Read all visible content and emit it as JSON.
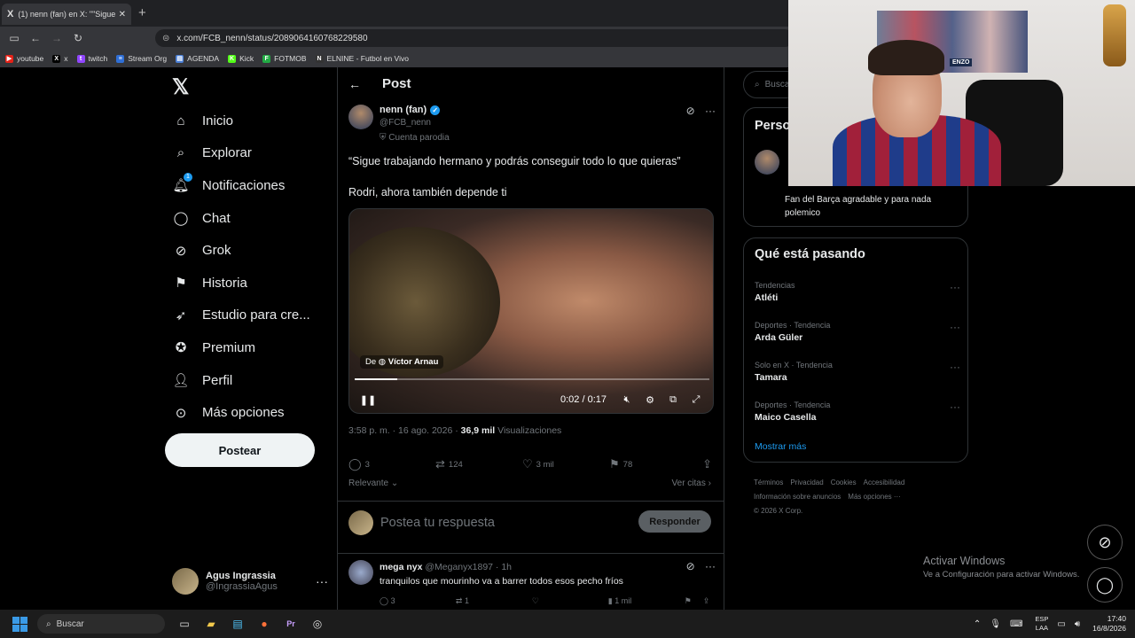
{
  "browser": {
    "tab_title": "(1) nenn (fan) en X: \"\"Sigue tra...",
    "url": "x.com/FCB_nenn/status/2089064160768229580",
    "bookmarks": [
      {
        "label": "youtube",
        "color": "#e62117",
        "glyph": "▶"
      },
      {
        "label": "x",
        "color": "#000000",
        "glyph": "X"
      },
      {
        "label": "twitch",
        "color": "#9146ff",
        "glyph": "t"
      },
      {
        "label": "Stream Org",
        "color": "#2f6fd6",
        "glyph": "≡"
      },
      {
        "label": "AGENDA",
        "color": "#4a7fd6",
        "glyph": "▤"
      },
      {
        "label": "Kick",
        "color": "#53fc18",
        "glyph": "K"
      },
      {
        "label": "FOTMOB",
        "color": "#22aa44",
        "glyph": "F"
      },
      {
        "label": "ELNINE - Futbol en Vivo",
        "color": "#333333",
        "glyph": "N"
      }
    ]
  },
  "nav": {
    "items": [
      {
        "label": "Inicio",
        "icon": "home-icon"
      },
      {
        "label": "Explorar",
        "icon": "search-icon"
      },
      {
        "label": "Notificaciones",
        "icon": "bell-icon",
        "badge": "1"
      },
      {
        "label": "Chat",
        "icon": "chat-icon"
      },
      {
        "label": "Grok",
        "icon": "grok-icon"
      },
      {
        "label": "Historia",
        "icon": "bookmark-icon"
      },
      {
        "label": "Estudio para cre...",
        "icon": "rocket-icon"
      },
      {
        "label": "Premium",
        "icon": "verified-icon"
      },
      {
        "label": "Perfil",
        "icon": "person-icon"
      },
      {
        "label": "Más opciones",
        "icon": "more-circle-icon"
      }
    ],
    "post_button": "Postear",
    "account_name": "Agus Ingrassia",
    "account_handle": "@IngrassiaAgus"
  },
  "post": {
    "header": "Post",
    "author_name": "nenn (fan)",
    "author_handle": "@FCB_nenn",
    "parody_label": "Cuenta parodia",
    "text1": "“Sigue trabajando hermano y podrás conseguir todo lo que quieras”",
    "text2": "Rodri, ahora también depende ti",
    "video": {
      "source_prefix": "De",
      "source_name": "Víctor Arnau",
      "time": "0:02 / 0:17",
      "progress": 0.12
    },
    "meta_time": "3:58 p. m. · 16 ago. 2026 ·",
    "meta_views": "36,9 mil",
    "meta_views_label": "Visualizaciones",
    "replies": "3",
    "reposts": "124",
    "likes": "3 mil",
    "bookmarks": "78",
    "sort_label": "Relevante",
    "quotes_label": "Ver citas",
    "reply_placeholder": "Postea tu respuesta",
    "reply_button": "Responder"
  },
  "comment": {
    "name": "mega nyx",
    "handle": "@Meganyx1897 · 1h",
    "text": "tranquilos que mourinho va a barrer todos esos pecho fríos",
    "replies": "3",
    "reposts": "1",
    "views": "1 mil"
  },
  "right": {
    "search_placeholder": "Busca",
    "person_title": "Perso",
    "person_bio": "Fan del Barça agradable y para nada polemico",
    "trends_title": "Qué está pasando",
    "trends": [
      {
        "category": "Tendencias",
        "name": "Atléti"
      },
      {
        "category": "Deportes · Tendencia",
        "name": "Arda Güler"
      },
      {
        "category": "Solo en X · Tendencia",
        "name": "Tamara"
      },
      {
        "category": "Deportes · Tendencia",
        "name": "Maico Casella"
      }
    ],
    "show_more": "Mostrar más",
    "footer": [
      "Términos",
      "Privacidad",
      "Cookies",
      "Accesibilidad",
      "Información sobre anuncios",
      "Más opciones ···",
      "© 2026 X Corp."
    ]
  },
  "webcam": {
    "jersey_label": "ENZO"
  },
  "windows": {
    "activate_title": "Activar Windows",
    "activate_sub": "Ve a Configuración para activar Windows.",
    "search": "Buscar",
    "lang_line1": "ESP",
    "lang_line2": "LAA",
    "time": "17:40",
    "date": "16/8/2026"
  }
}
